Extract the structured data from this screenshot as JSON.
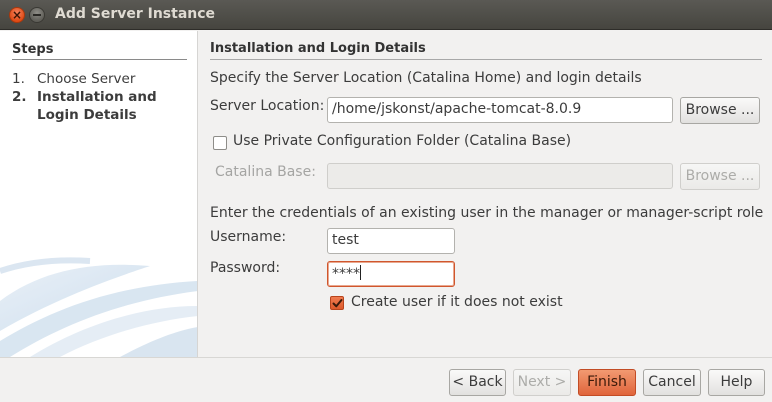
{
  "window": {
    "title": "Add Server Instance"
  },
  "steps": {
    "title": "Steps",
    "items": [
      {
        "num": "1.",
        "line1": "Choose Server",
        "line2": ""
      },
      {
        "num": "2.",
        "line1": "Installation and",
        "line2": "Login Details"
      }
    ]
  },
  "form": {
    "section_title": "Installation and Login Details",
    "description": "Specify the Server Location (Catalina Home) and login details",
    "server_location_label": "Server Location:",
    "server_location_value": "/home/jskonst/apache-tomcat-8.0.9",
    "browse_label": "Browse ...",
    "private_config_label": "Use Private Configuration Folder (Catalina Base)",
    "private_config_checked": false,
    "catalina_base_label": "Catalina Base:",
    "catalina_base_value": "",
    "browse2_label": "Browse ...",
    "credentials_text": "Enter the credentials of an existing user in the manager or manager-script role",
    "username_label": "Username:",
    "username_value": "test",
    "password_label": "Password:",
    "password_value": "****",
    "create_user_label": "Create user if it does not exist",
    "create_user_checked": true
  },
  "footer": {
    "back_label": "< Back",
    "next_label": "Next >",
    "finish_label": "Finish",
    "cancel_label": "Cancel",
    "help_label": "Help"
  },
  "colors": {
    "accent": "#e0643b",
    "titlebar": "#4d4c47",
    "close_button": "#df4b16"
  }
}
